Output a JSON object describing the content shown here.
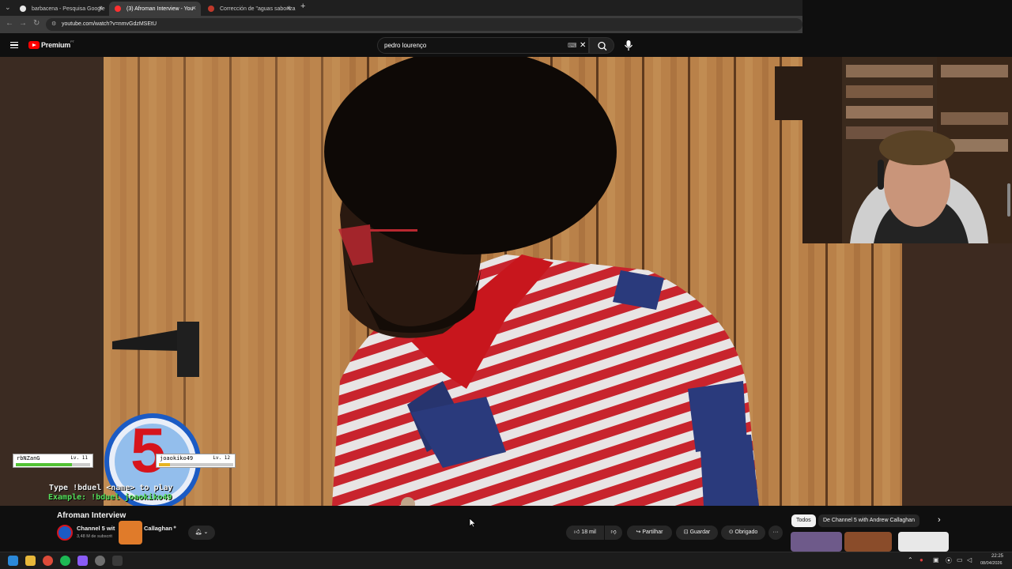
{
  "browser": {
    "tabs": [
      {
        "title": "barbacena - Pesquisa Google",
        "icon": "google-icon"
      },
      {
        "title": "(3) Afroman Interview - You",
        "icon": "youtube-icon"
      },
      {
        "title": "Corrección de \"aguas saboriza",
        "icon": "page-icon"
      }
    ],
    "new_tab": "+",
    "url": "youtube.com/watch?v=nmvGdzMSEtU"
  },
  "youtube": {
    "logo": "Premium",
    "logo_sup": "PT",
    "search_value": "pedro lourenço"
  },
  "overlay": {
    "player1_name": "rbNZanG",
    "player1_level": "Lv. 11",
    "player2_name": "joaokiko49",
    "player2_level": "Lv. 12",
    "player1_hp": 0.75,
    "player2_hp": 0.15,
    "instruction": "Type !bduel <name> to play",
    "example": "Example: !bduel joaokiko49",
    "channel_logo_number": "5"
  },
  "video_info": {
    "title": "Afroman Interview",
    "channel": "Channel 5 with Andrew Callaghan",
    "channel_prefix": "Channel 5 wit",
    "channel_suffix": "Callaghan",
    "subscribers": "3,48 M de subscrit",
    "likes": "18 mil",
    "share": "Partilhar",
    "save": "Guardar",
    "thanks": "Obrigado",
    "more": "···"
  },
  "recommendations": {
    "chips": [
      "Todos",
      "De Channel 5 with Andrew Callaghan"
    ]
  },
  "taskbar": {
    "time": "22:25",
    "date": "08/04/2026"
  },
  "colors": {
    "yt_red": "#ff0000",
    "chip_active": "#f1f1f1",
    "background": "#0f0f0f"
  }
}
